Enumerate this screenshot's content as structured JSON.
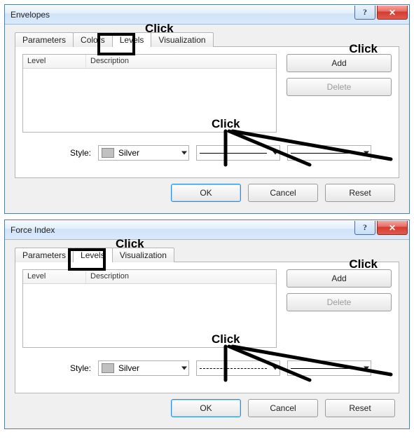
{
  "dialog1": {
    "title": "Envelopes",
    "tabs": [
      "Parameters",
      "Colors",
      "Levels",
      "Visualization"
    ],
    "active_tab_index": 2,
    "list_columns": {
      "level": "Level",
      "description": "Description"
    },
    "buttons": {
      "add": "Add",
      "delete": "Delete"
    },
    "style": {
      "label": "Style:",
      "color_name": "Silver",
      "line_pattern": "solid"
    },
    "footer": {
      "ok": "OK",
      "cancel": "Cancel",
      "reset": "Reset"
    },
    "annotations": {
      "tab_click": "Click",
      "add_click": "Click",
      "combo_click": "Click",
      "highlight_tab": "Levels"
    }
  },
  "dialog2": {
    "title": "Force Index",
    "tabs": [
      "Parameters",
      "Levels",
      "Visualization"
    ],
    "active_tab_index": 1,
    "list_columns": {
      "level": "Level",
      "description": "Description"
    },
    "buttons": {
      "add": "Add",
      "delete": "Delete"
    },
    "style": {
      "label": "Style:",
      "color_name": "Silver",
      "line_pattern": "dashed"
    },
    "footer": {
      "ok": "OK",
      "cancel": "Cancel",
      "reset": "Reset"
    },
    "annotations": {
      "tab_click": "Click",
      "add_click": "Click",
      "combo_click": "Click",
      "highlight_tab": "Levels"
    }
  },
  "icons": {
    "help": "?",
    "close": "✕"
  }
}
